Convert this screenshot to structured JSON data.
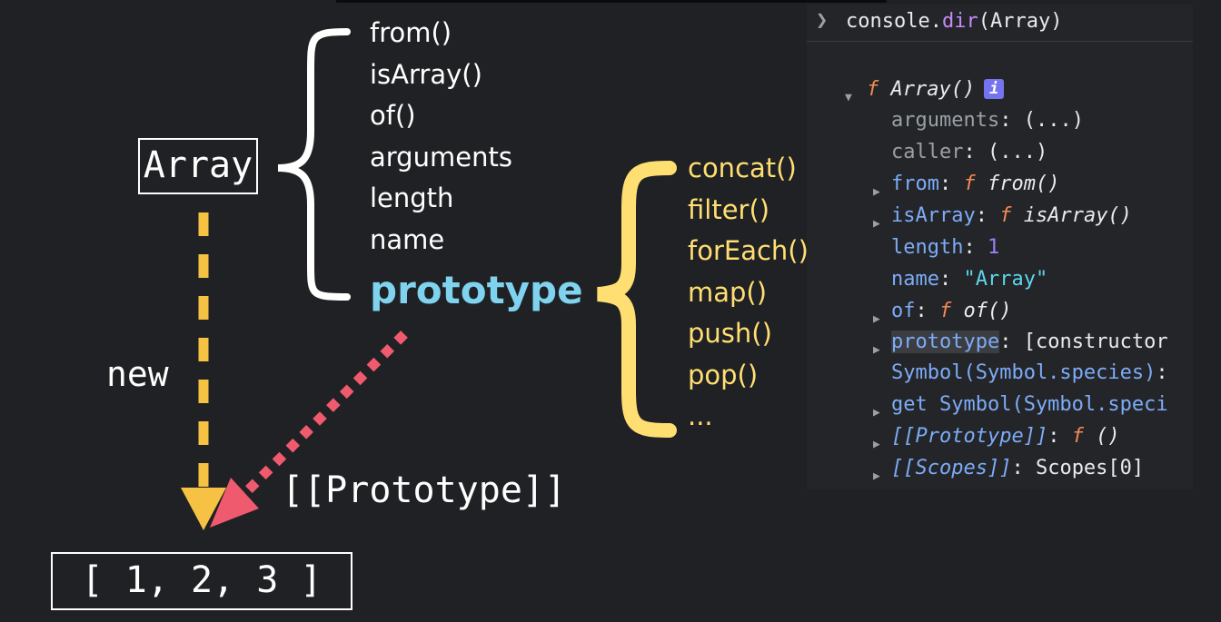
{
  "diagram": {
    "constructor_label": "Array",
    "static_members": [
      "from()",
      "isArray()",
      "of()",
      "arguments",
      "length",
      "name"
    ],
    "prototype_label": "prototype",
    "prototype_methods": [
      "concat()",
      "filter()",
      "forEach()",
      "map()",
      "push()",
      "pop()",
      "..."
    ],
    "new_label": "new",
    "proto_link_label": "[[Prototype]]",
    "instance_label": "[ 1, 2, 3 ]",
    "colors": {
      "background": "#202124",
      "prototype_text": "#7fd3ef",
      "prototype_methods": "#ffdf72",
      "new_arrow": "#f6c243",
      "proto_arrow": "#f05a6e"
    }
  },
  "console": {
    "command_prefix": "console.",
    "command_fn": "dir",
    "command_args": "(Array)",
    "root": {
      "f": "f",
      "name": "Array()",
      "info": "i"
    },
    "rows": {
      "arguments_key": "arguments",
      "arguments_val": "(...)",
      "caller_key": "caller",
      "caller_val": "(...)",
      "from_key": "from",
      "from_f": "f",
      "from_val": "from()",
      "isArray_key": "isArray",
      "isArray_f": "f",
      "isArray_val": "isArray()",
      "length_key": "length",
      "length_val": "1",
      "name_key": "name",
      "name_val": "\"Array\"",
      "of_key": "of",
      "of_f": "f",
      "of_val": "of()",
      "prototype_key": "prototype",
      "prototype_val": "[constructor",
      "symbol_key": "Symbol(Symbol.species)",
      "get_symbol_key": "get Symbol(Symbol.speci",
      "proto_key": "[[Prototype]]",
      "proto_f": "f",
      "proto_val": "()",
      "scopes_key": "[[Scopes]]",
      "scopes_val": "Scopes[0]"
    }
  }
}
